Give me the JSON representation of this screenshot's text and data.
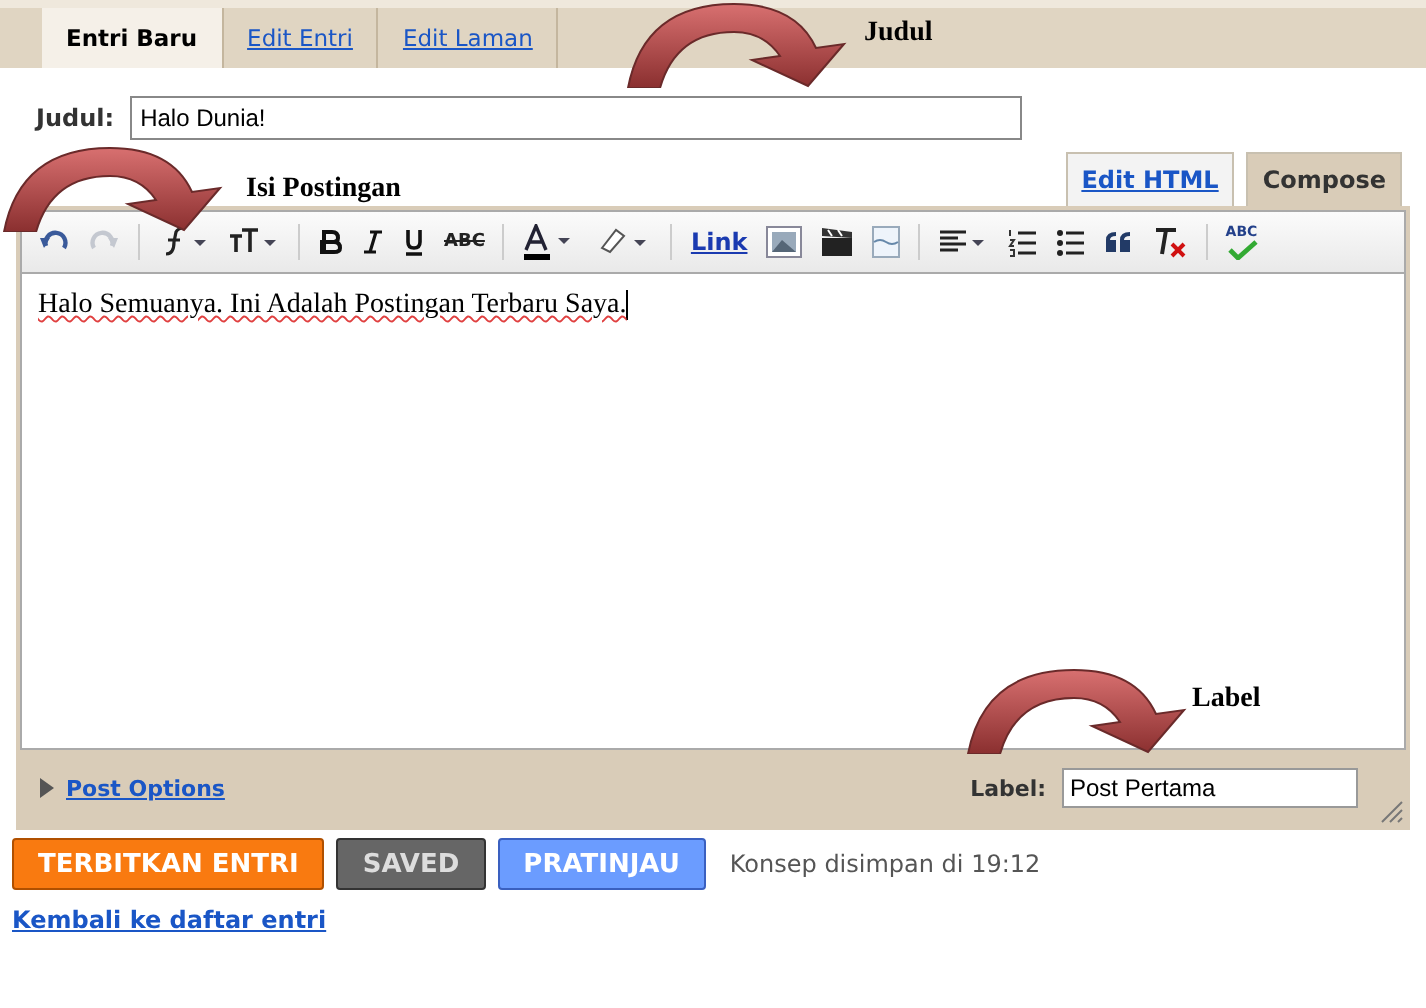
{
  "tabs": [
    {
      "label": "Entri Baru",
      "selected": true
    },
    {
      "label": "Edit Entri",
      "selected": false
    },
    {
      "label": "Edit Laman",
      "selected": false
    }
  ],
  "title_field": {
    "label": "Judul:",
    "value": "Halo Dunia!"
  },
  "editor_modes": [
    {
      "label": "Edit HTML",
      "selected": false
    },
    {
      "label": "Compose",
      "selected": true
    }
  ],
  "toolbar": {
    "redo_disabled": true,
    "strikethrough_label": "ABC",
    "link_label": "Link",
    "spellcheck_label": "ABC"
  },
  "body_text": "Halo Semuanya. Ini Adalah Postingan Terbaru Saya.",
  "footer": {
    "post_options": "Post Options",
    "label_caption": "Label:",
    "label_value": "Post Pertama"
  },
  "buttons": [
    {
      "label": "TERBITKAN ENTRI",
      "kind": "publish"
    },
    {
      "label": "SAVED",
      "kind": "saved"
    },
    {
      "label": "PRATINJAU",
      "kind": "preview"
    }
  ],
  "save_status": "Konsep disimpan di 19:12",
  "back_link": "Kembali ke daftar entri",
  "annotations": [
    {
      "text": "Judul"
    },
    {
      "text": "Isi Postingan"
    },
    {
      "text": "Label"
    }
  ]
}
